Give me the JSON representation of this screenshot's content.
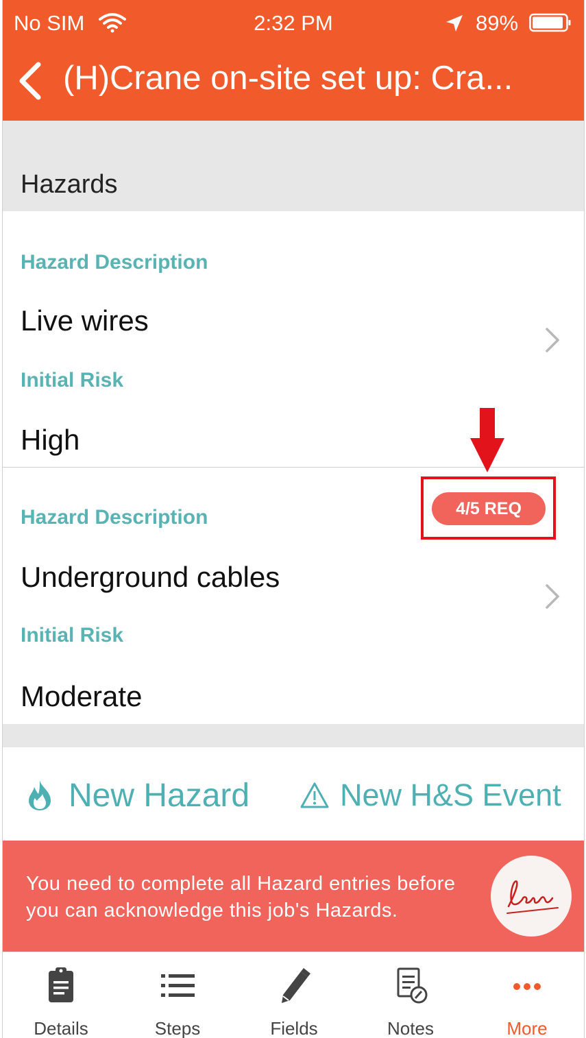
{
  "status_bar": {
    "carrier": "No SIM",
    "time": "2:32 PM",
    "battery": "89%"
  },
  "header": {
    "back_label": "Back",
    "title": "(H)Crane on-site set up: Cra..."
  },
  "section": {
    "title": "Hazards"
  },
  "hazards": [
    {
      "description_label": "Hazard Description",
      "description": "Live wires",
      "risk_label": "Initial Risk",
      "risk": "High"
    },
    {
      "description_label": "Hazard Description",
      "description": "Underground cables",
      "risk_label": "Initial Risk",
      "risk": "Moderate",
      "badge": "4/5 REQ"
    }
  ],
  "actions": {
    "new_hazard": "New Hazard",
    "new_event": "New H&S Event"
  },
  "banner": {
    "message": "You need to complete all Hazard entries before you can acknowledge this job's Hazards."
  },
  "tabs": [
    {
      "label": "Details",
      "icon": "clipboard-icon"
    },
    {
      "label": "Steps",
      "icon": "list-icon"
    },
    {
      "label": "Fields",
      "icon": "pencil-icon"
    },
    {
      "label": "Notes",
      "icon": "notes-icon"
    },
    {
      "label": "More",
      "icon": "more-icon",
      "active": true
    }
  ],
  "colors": {
    "accent": "#f15a2b",
    "teal": "#5ab3b3",
    "alert": "#f1645c",
    "annotation": "#e3131b"
  }
}
